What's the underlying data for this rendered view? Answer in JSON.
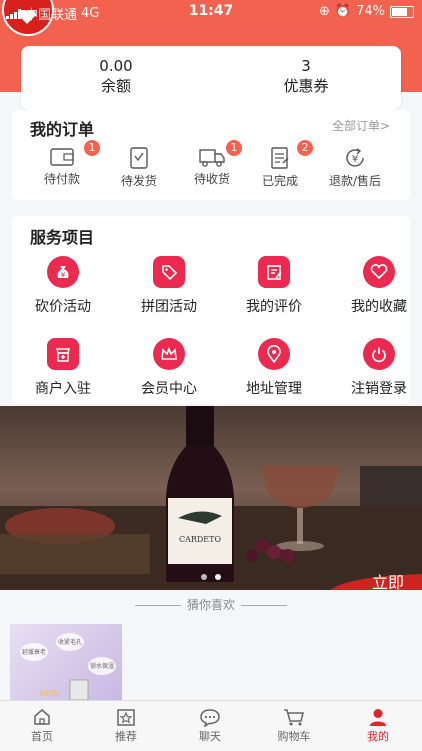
{
  "status_bar": {
    "carrier": "中国联通",
    "network": "4G",
    "time": "11:47",
    "battery": "74%"
  },
  "balance": {
    "balance_value": "0.00",
    "balance_label": "余额",
    "coupon_value": "3",
    "coupon_label": "优惠券"
  },
  "orders": {
    "title": "我的订单",
    "all_link": "全部订单>",
    "items": [
      {
        "label": "待付款",
        "icon": "wallet-icon",
        "badge": "1"
      },
      {
        "label": "待发货",
        "icon": "package-icon",
        "badge": ""
      },
      {
        "label": "待收货",
        "icon": "truck-icon",
        "badge": "1"
      },
      {
        "label": "已完成",
        "icon": "document-check-icon",
        "badge": "2"
      },
      {
        "label": "退款/售后",
        "icon": "refund-icon",
        "badge": ""
      }
    ]
  },
  "services": {
    "title": "服务项目",
    "items": [
      {
        "label": "砍价活动",
        "icon": "money-bag-icon"
      },
      {
        "label": "拼团活动",
        "icon": "tag-icon"
      },
      {
        "label": "我的评价",
        "icon": "edit-note-icon"
      },
      {
        "label": "我的收藏",
        "icon": "heart-icon"
      },
      {
        "label": "商户入驻",
        "icon": "store-add-icon"
      },
      {
        "label": "会员中心",
        "icon": "crown-icon"
      },
      {
        "label": "地址管理",
        "icon": "location-pin-icon"
      },
      {
        "label": "注销登录",
        "icon": "power-icon"
      }
    ]
  },
  "banner": {
    "bottle_label": "CARDETO",
    "corner_text": "立即",
    "active_dot": 2,
    "dot_count": 2
  },
  "guess": {
    "title": "猜你喜欢",
    "product_tags": [
      "延缓衰老",
      "收紧毛孔",
      "锁水保湿",
      "NEW"
    ]
  },
  "tabbar": {
    "items": [
      {
        "label": "首页",
        "icon": "home-icon"
      },
      {
        "label": "推荐",
        "icon": "star-icon"
      },
      {
        "label": "聊天",
        "icon": "chat-icon"
      },
      {
        "label": "购物车",
        "icon": "cart-icon"
      },
      {
        "label": "我的",
        "icon": "user-icon"
      }
    ],
    "active": "我的",
    "active_color": "#e0242c"
  },
  "colors": {
    "header": "#f2624f",
    "accent": "#ec2a4f",
    "badge": "#f2624f"
  }
}
